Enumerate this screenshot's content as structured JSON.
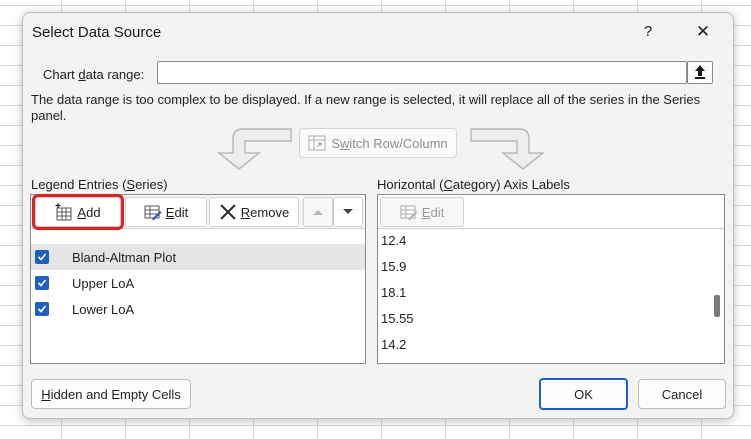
{
  "dialog": {
    "title": "Select Data Source",
    "help": "?",
    "close": "✕"
  },
  "chart_range": {
    "label_pre": "Chart ",
    "label_ul": "d",
    "label_post": "ata range:",
    "value": ""
  },
  "message": "The data range is too complex to be displayed. If a new range is selected, it will replace all of the series in the Series panel.",
  "switch_button": {
    "label_pre": "S",
    "label_ul": "w",
    "label_post": "itch Row/Column"
  },
  "legend": {
    "label_pre": "Legend Entries (",
    "label_ul": "S",
    "label_post": "eries)",
    "add_ul": "A",
    "add_rest": "dd",
    "edit_ul": "E",
    "edit_rest": "dit",
    "remove_ul": "R",
    "remove_rest": "emove",
    "series": [
      {
        "label": "Bland-Altman Plot",
        "checked": true
      },
      {
        "label": "Upper LoA",
        "checked": true
      },
      {
        "label": "Lower LoA",
        "checked": true
      }
    ]
  },
  "axis": {
    "label_pre": "Horizontal (",
    "label_ul": "C",
    "label_post": "ategory) Axis Labels",
    "edit_ul": "E",
    "edit_rest": "dit",
    "values": [
      "12.4",
      "15.9",
      "18.1",
      "15.55",
      "14.2"
    ]
  },
  "buttons": {
    "hidden_ul": "H",
    "hidden_rest": "idden and Empty Cells",
    "ok": "OK",
    "cancel": "Cancel"
  },
  "colors": {
    "accent": "#1f5fbf",
    "highlight": "#e02020"
  }
}
